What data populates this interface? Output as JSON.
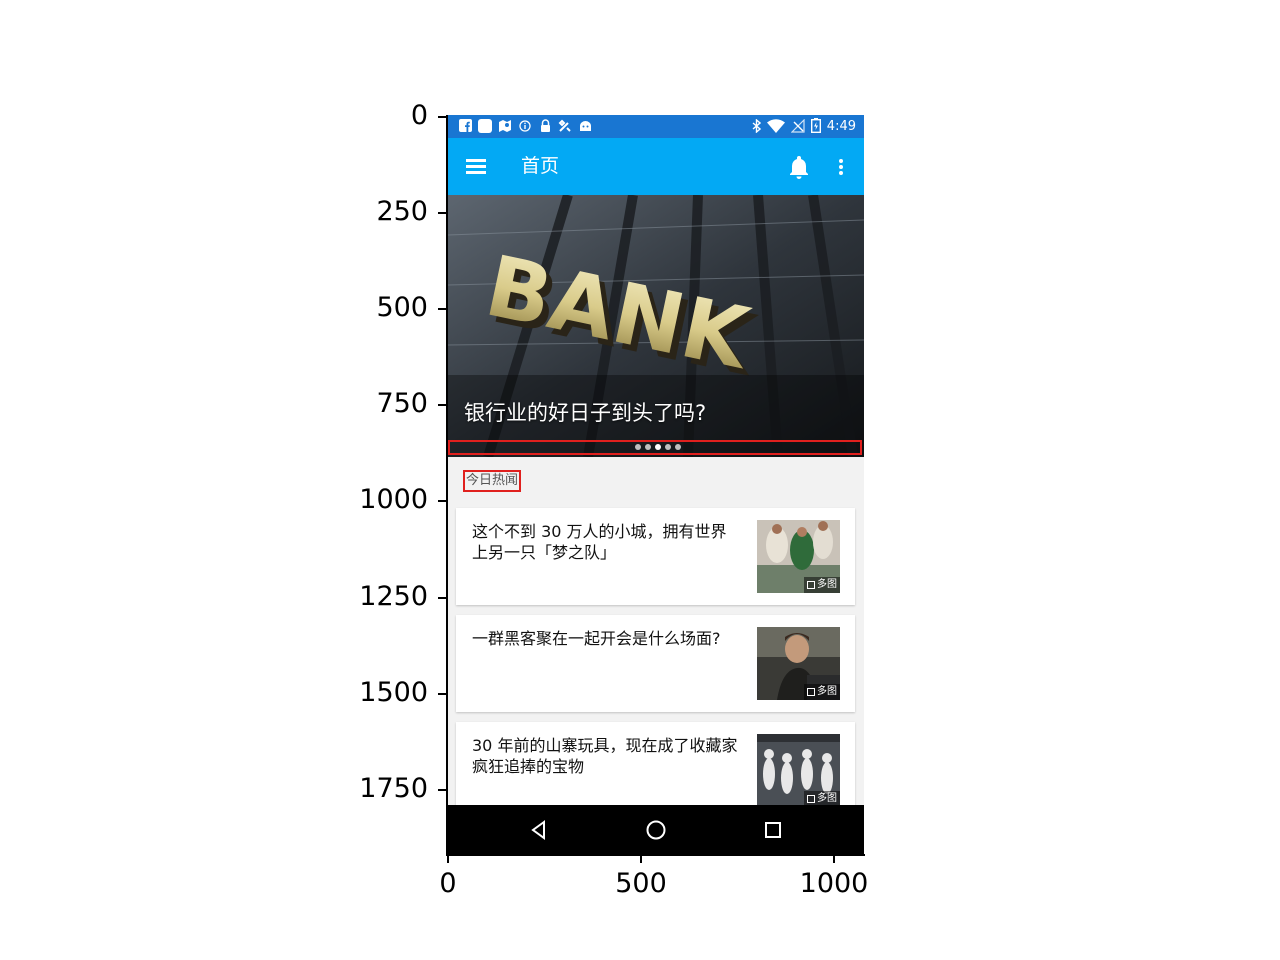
{
  "figure": {
    "y_ticks": [
      "0",
      "250",
      "500",
      "750",
      "1000",
      "1250",
      "1500",
      "1750"
    ],
    "x_ticks": [
      "0",
      "500",
      "1000"
    ]
  },
  "status_bar": {
    "time": "4:49",
    "left_icons": [
      "facebook-icon",
      "app-icon",
      "maps-icon",
      "info-icon",
      "lock-icon",
      "tools-icon",
      "android-icon"
    ],
    "right_icons": [
      "bluetooth-icon",
      "wifi-icon",
      "no-signal-icon",
      "battery-icon"
    ]
  },
  "app_bar": {
    "title": "首页",
    "menu_icon": "menu-icon",
    "bell_icon": "bell-icon",
    "more_icon": "more-vert-icon",
    "color": "#03a9f4"
  },
  "banner": {
    "sign_text": "BANK",
    "caption": "银行业的好日子到头了吗?",
    "dots_count": 5,
    "active_dot": 2
  },
  "section": {
    "hot_label": "今日热闻"
  },
  "news": [
    {
      "title": "这个不到 30 万人的小城，拥有世界上另一只「梦之队」",
      "badge": "多图"
    },
    {
      "title": "一群黑客聚在一起开会是什么场面?",
      "badge": "多图"
    },
    {
      "title": "30 年前的山寨玩具，现在成了收藏家疯狂追捧的宝物",
      "badge": "多图"
    }
  ],
  "nav_bar": {
    "buttons": [
      "back-icon",
      "home-icon",
      "recents-icon"
    ]
  },
  "colors": {
    "status_bar": "#1976d2",
    "highlight_box": "#e0201e"
  }
}
